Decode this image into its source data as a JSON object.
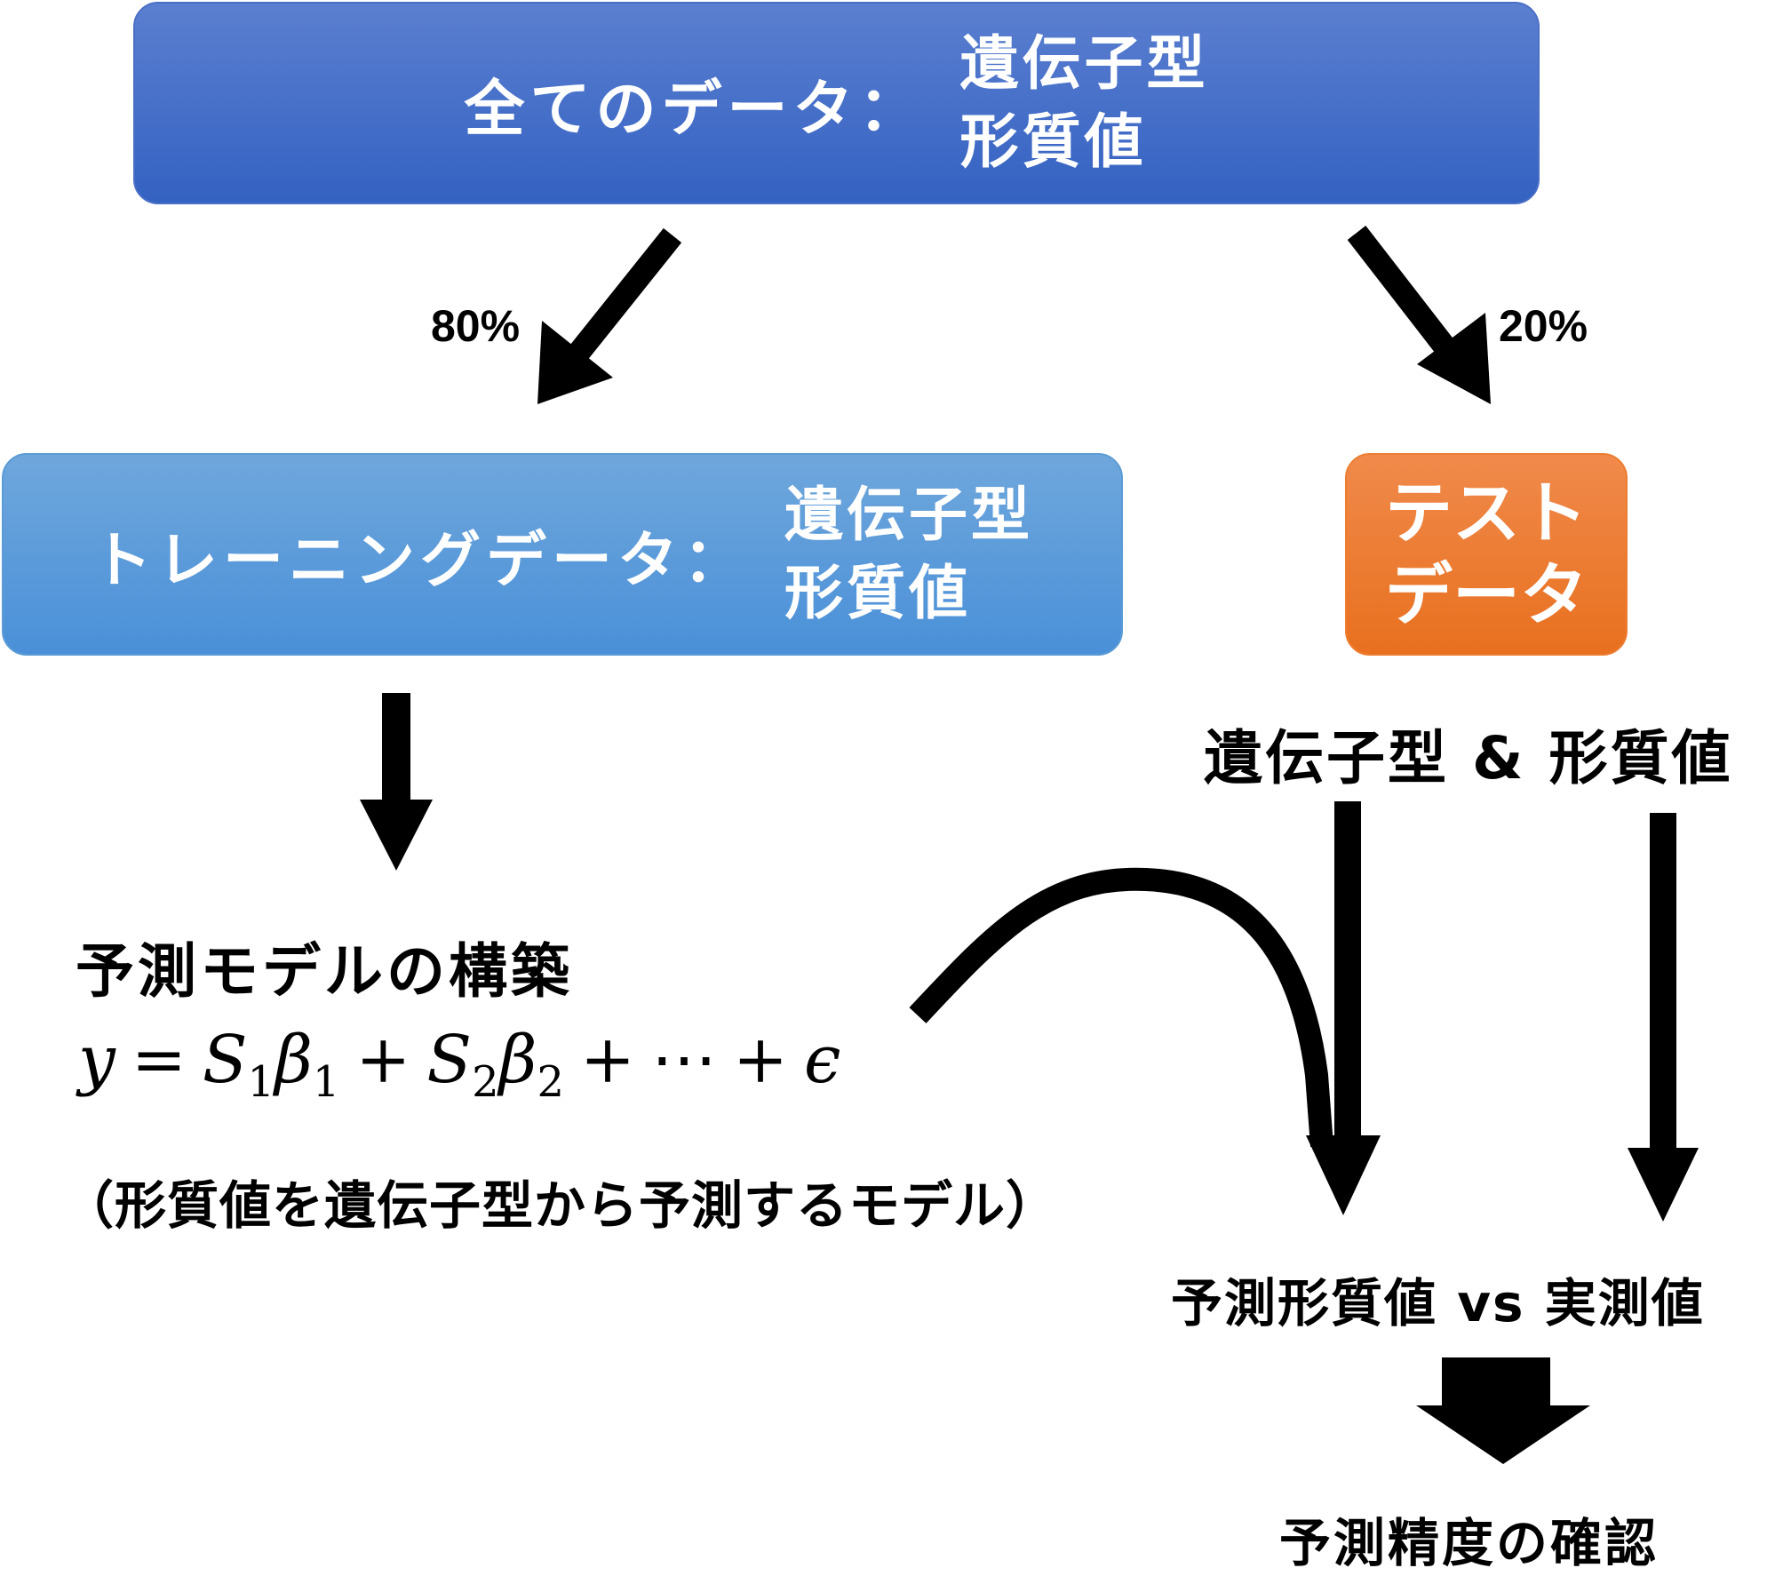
{
  "all_data": {
    "label": "全てのデータ：",
    "items": [
      "遺伝子型",
      "形質値"
    ]
  },
  "split": {
    "train_pct": "80%",
    "test_pct": "20%"
  },
  "training_data": {
    "label": "トレーニングデータ：",
    "items": [
      "遺伝子型",
      "形質値"
    ]
  },
  "test_data": {
    "lines": [
      "テスト",
      "データ"
    ]
  },
  "test_contents": "遺伝子型 & 形質値",
  "model": {
    "title": "予測モデルの構築",
    "formula": {
      "y": "y",
      "eq": "=",
      "term1_s": "S",
      "term1_s_sub": "1",
      "term1_b": "β",
      "term1_b_sub": "1",
      "plus1": "+",
      "term2_s": "S",
      "term2_s_sub": "2",
      "term2_b": "β",
      "term2_b_sub": "2",
      "plus2": "+",
      "dots": "⋯",
      "plus3": "+",
      "eps": "ϵ"
    },
    "note": "（形質値を遺伝子型から予測するモデル）"
  },
  "comparison": "予測形質値 vs 実測値",
  "result": "予測精度の確認"
}
